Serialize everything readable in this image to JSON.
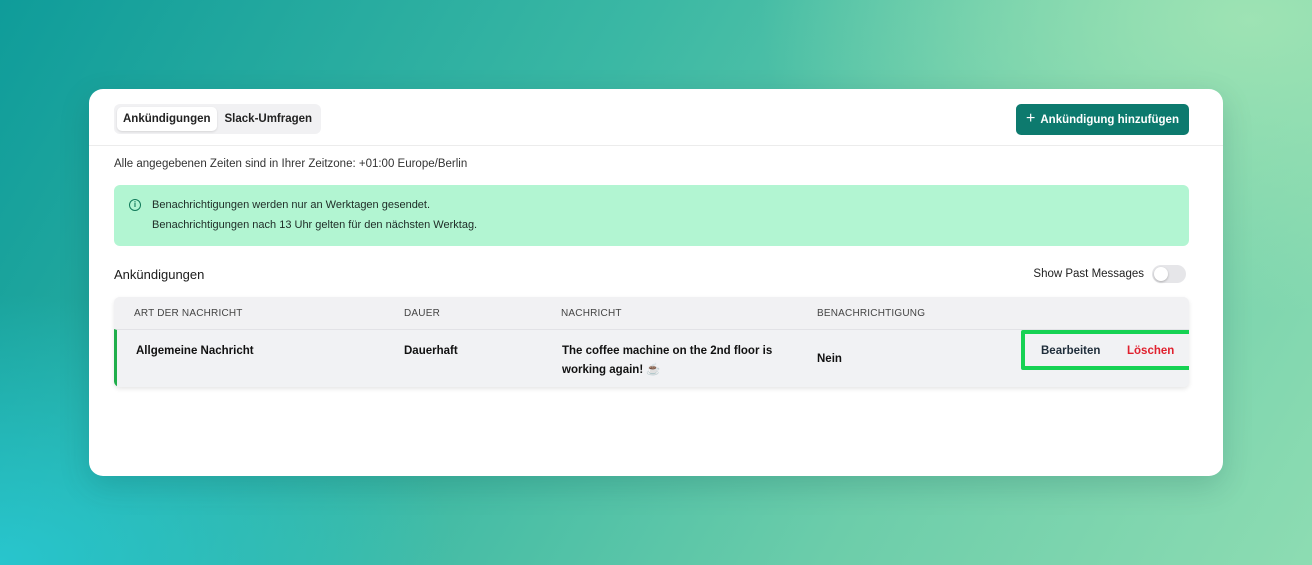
{
  "tabs": [
    {
      "label": "Ankündigungen",
      "active": true
    },
    {
      "label": "Slack-Umfragen",
      "active": false
    }
  ],
  "add_button": {
    "icon": "plus-icon",
    "label": "Ankündigung hinzufügen"
  },
  "timezone_note": "Alle angegebenen Zeiten sind in Ihrer Zeitzone: +01:00 Europe/Berlin",
  "notice": {
    "icon": "info-icon",
    "line1": "Benachrichtigungen werden nur an Werktagen gesendet.",
    "line2": "Benachrichtigungen nach 13 Uhr gelten für den nächsten Werktag."
  },
  "section_title": "Ankündigungen",
  "show_past": {
    "label": "Show Past Messages",
    "enabled": false
  },
  "table": {
    "headers": [
      "ART DER NACHRICHT",
      "DAUER",
      "NACHRICHT",
      "BENACHRICHTIGUNG"
    ],
    "rows": [
      {
        "type": "Allgemeine Nachricht",
        "duration": "Dauerhaft",
        "message_line1": "The coffee machine on the 2nd floor is",
        "message_line2": "working again! ☕",
        "notification": "Nein",
        "edit_label": "Bearbeiten",
        "delete_label": "Löschen"
      }
    ]
  },
  "colors": {
    "primary": "#0d7a6e",
    "notice_bg": "#b2f5d2",
    "row_accent": "#1fae4b",
    "highlight": "#16d253",
    "delete": "#e0212e"
  }
}
